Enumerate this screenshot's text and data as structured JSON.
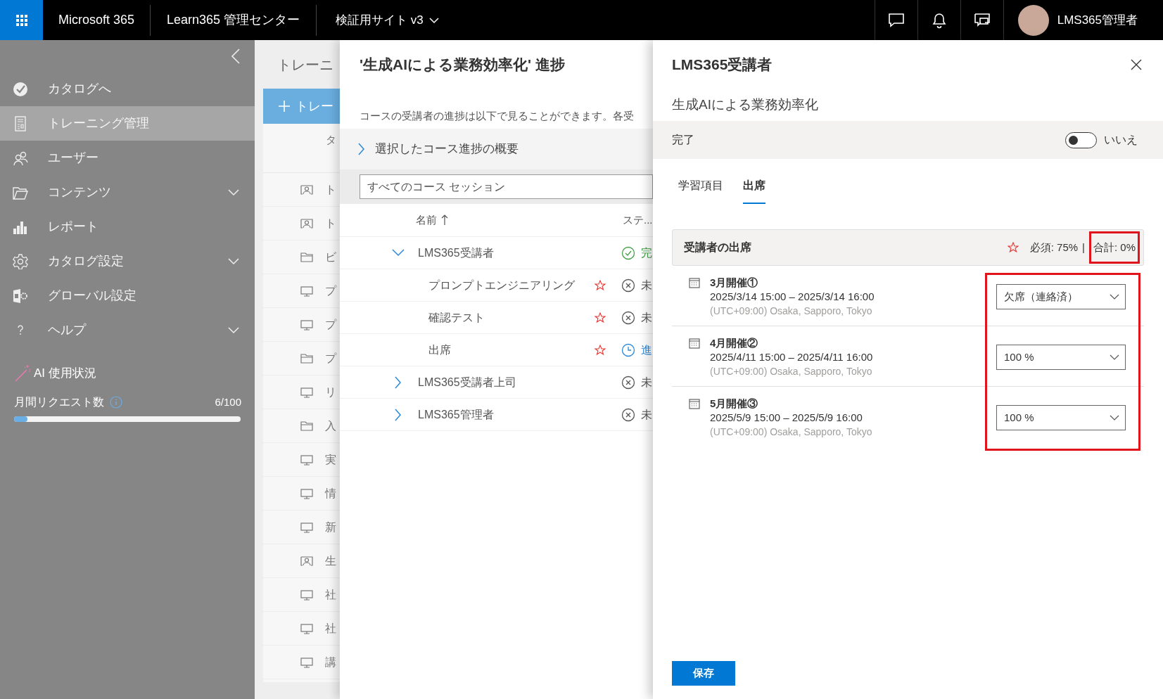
{
  "top_bar": {
    "app_name": "Microsoft 365",
    "admin_center": "Learn365 管理センター",
    "site": "検証用サイト v3",
    "user": "LMS365管理者"
  },
  "sidebar": {
    "items": [
      {
        "label": "カタログへ",
        "selected": false,
        "expandable": false
      },
      {
        "label": "トレーニング管理",
        "selected": true,
        "expandable": false
      },
      {
        "label": "ユーザー",
        "selected": false,
        "expandable": false
      },
      {
        "label": "コンテンツ",
        "selected": false,
        "expandable": true
      },
      {
        "label": "レポート",
        "selected": false,
        "expandable": false
      },
      {
        "label": "カタログ設定",
        "selected": false,
        "expandable": true
      },
      {
        "label": "グローバル設定",
        "selected": false,
        "expandable": false
      },
      {
        "label": "ヘルプ",
        "selected": false,
        "expandable": true
      }
    ],
    "ai_usage": {
      "title": "AI 使用状況",
      "label": "月間リクエスト数",
      "count": "6/100",
      "level": 0.06
    }
  },
  "training_list": {
    "title": "トレーニ",
    "add_button": "トレー",
    "column": "タ",
    "rows": [
      {
        "kind": "presenter",
        "text": "ト"
      },
      {
        "kind": "presenter",
        "text": "ト"
      },
      {
        "kind": "folder",
        "text": "ビ"
      },
      {
        "kind": "monitor",
        "text": "プ"
      },
      {
        "kind": "monitor",
        "text": "プ"
      },
      {
        "kind": "folder",
        "text": "プ"
      },
      {
        "kind": "monitor",
        "text": "リ"
      },
      {
        "kind": "folder",
        "text": "入"
      },
      {
        "kind": "monitor",
        "text": "実"
      },
      {
        "kind": "monitor",
        "text": "情"
      },
      {
        "kind": "monitor",
        "text": "新"
      },
      {
        "kind": "presenter",
        "text": "生"
      },
      {
        "kind": "monitor",
        "text": "社"
      },
      {
        "kind": "monitor",
        "text": "社"
      },
      {
        "kind": "monitor",
        "text": "講"
      }
    ]
  },
  "progress_panel": {
    "title": "'生成AIによる業務効率化' 進捗",
    "description": "コースの受講者の進捗は以下で見ることができます。各受",
    "summary": {
      "label": "選択したコース進捗の概要",
      "expanded": false
    },
    "session_filter": {
      "value": "すべてのコース セッション"
    },
    "columns": [
      "名前",
      "ステ..."
    ],
    "rows": [
      {
        "name": "LMS365受講者",
        "expanded": true,
        "kind": "completed",
        "status": "完",
        "children": [
          {
            "name": "プロンプトエンジニアリング",
            "required": true,
            "kind": "not_started",
            "status": "未"
          },
          {
            "name": "確認テスト",
            "required": true,
            "kind": "not_started",
            "status": "未"
          },
          {
            "name": "出席",
            "required": true,
            "kind": "in_progress",
            "status": "進"
          }
        ]
      },
      {
        "name": "LMS365受講者上司",
        "expanded": false,
        "kind": "not_started",
        "status": "未"
      },
      {
        "name": "LMS365管理者",
        "expanded": false,
        "kind": "not_started",
        "status": "未"
      }
    ]
  },
  "detail_panel": {
    "title": "LMS365受講者",
    "course": "生成AIによる業務効率化",
    "completion": {
      "label": "完了",
      "on": false,
      "value": "いいえ"
    },
    "tabs": [
      {
        "label": "学習項目",
        "selected": false
      },
      {
        "label": "出席",
        "selected": true
      }
    ],
    "attendance": {
      "title": "受講者の出席",
      "required": "必須: 75%",
      "separator": "|",
      "total": "合計: 0%",
      "total_highlighted": true,
      "sessions_highlighted": true,
      "sessions": [
        {
          "title": "3月開催①",
          "time": "2025/3/14 15:00 – 2025/3/14 16:00",
          "timezone": "(UTC+09:00) Osaka, Sapporo, Tokyo",
          "value": "欠席（連絡済）"
        },
        {
          "title": "4月開催②",
          "time": "2025/4/11 15:00 – 2025/4/11 16:00",
          "timezone": "(UTC+09:00) Osaka, Sapporo, Tokyo",
          "value": "100 %"
        },
        {
          "title": "5月開催③",
          "time": "2025/5/9 15:00 – 2025/5/9 16:00",
          "timezone": "(UTC+09:00) Osaka, Sapporo, Tokyo",
          "value": "100 %"
        }
      ]
    },
    "save_button": "保存"
  }
}
